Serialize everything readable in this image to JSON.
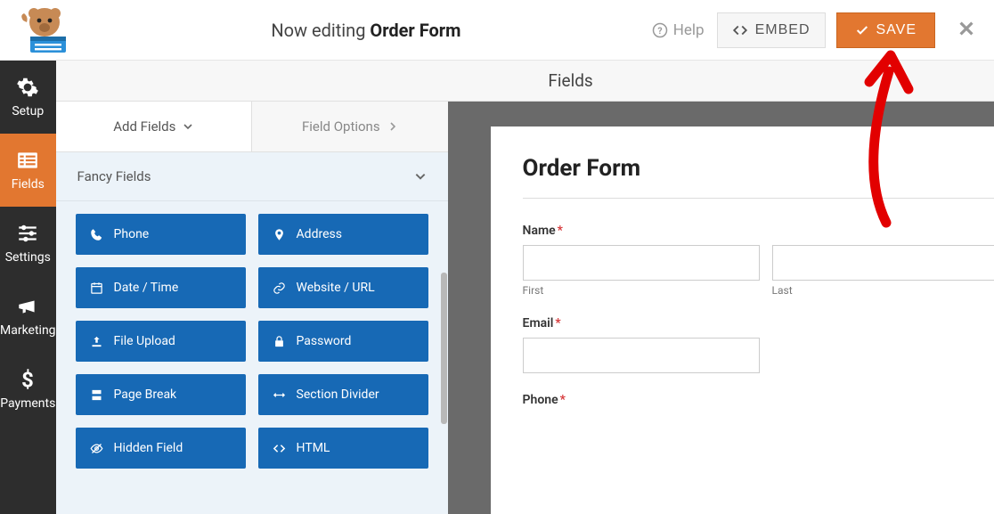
{
  "header": {
    "editing_prefix": "Now editing",
    "form_name": "Order Form",
    "help_label": "Help",
    "embed_label": "EMBED",
    "save_label": "SAVE"
  },
  "sidebar": {
    "items": [
      {
        "key": "setup",
        "label": "Setup"
      },
      {
        "key": "fields",
        "label": "Fields"
      },
      {
        "key": "settings",
        "label": "Settings"
      },
      {
        "key": "marketing",
        "label": "Marketing"
      },
      {
        "key": "payments",
        "label": "Payments"
      }
    ],
    "active_key": "fields"
  },
  "panel": {
    "header": "Fields",
    "tabs": {
      "add": "Add Fields",
      "options": "Field Options"
    },
    "section_title": "Fancy Fields",
    "fields": [
      {
        "key": "phone",
        "label": "Phone"
      },
      {
        "key": "address",
        "label": "Address"
      },
      {
        "key": "datetime",
        "label": "Date / Time"
      },
      {
        "key": "url",
        "label": "Website / URL"
      },
      {
        "key": "upload",
        "label": "File Upload"
      },
      {
        "key": "password",
        "label": "Password"
      },
      {
        "key": "pagebreak",
        "label": "Page Break"
      },
      {
        "key": "divider",
        "label": "Section Divider"
      },
      {
        "key": "hidden",
        "label": "Hidden Field"
      },
      {
        "key": "html",
        "label": "HTML"
      }
    ]
  },
  "preview": {
    "title": "Order Form",
    "name_label": "Name",
    "first_sublabel": "First",
    "last_sublabel": "Last",
    "email_label": "Email",
    "phone_label": "Phone"
  },
  "colors": {
    "orange": "#e27730",
    "blue": "#1769b5",
    "red": "#d63638"
  }
}
